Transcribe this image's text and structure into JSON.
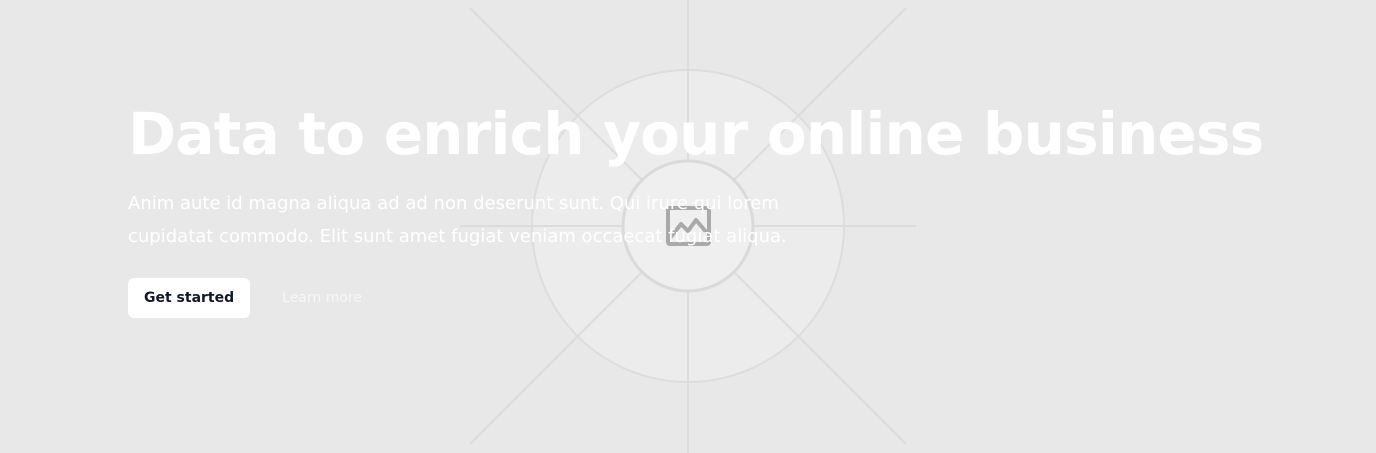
{
  "hero": {
    "headline": "Data to enrich your online business",
    "subtext": "Anim aute id magna aliqua ad ad non deserunt sunt. Qui irure qui lorem cupidatat commodo. Elit sunt amet fugiat veniam occaecat fugiat aliqua.",
    "primary_cta": "Get started",
    "secondary_cta": "Learn more",
    "background_image_icon": "image-placeholder-icon"
  },
  "colors": {
    "background": "#e8e8e8",
    "text": "#ffffff",
    "button_text": "#111827"
  }
}
